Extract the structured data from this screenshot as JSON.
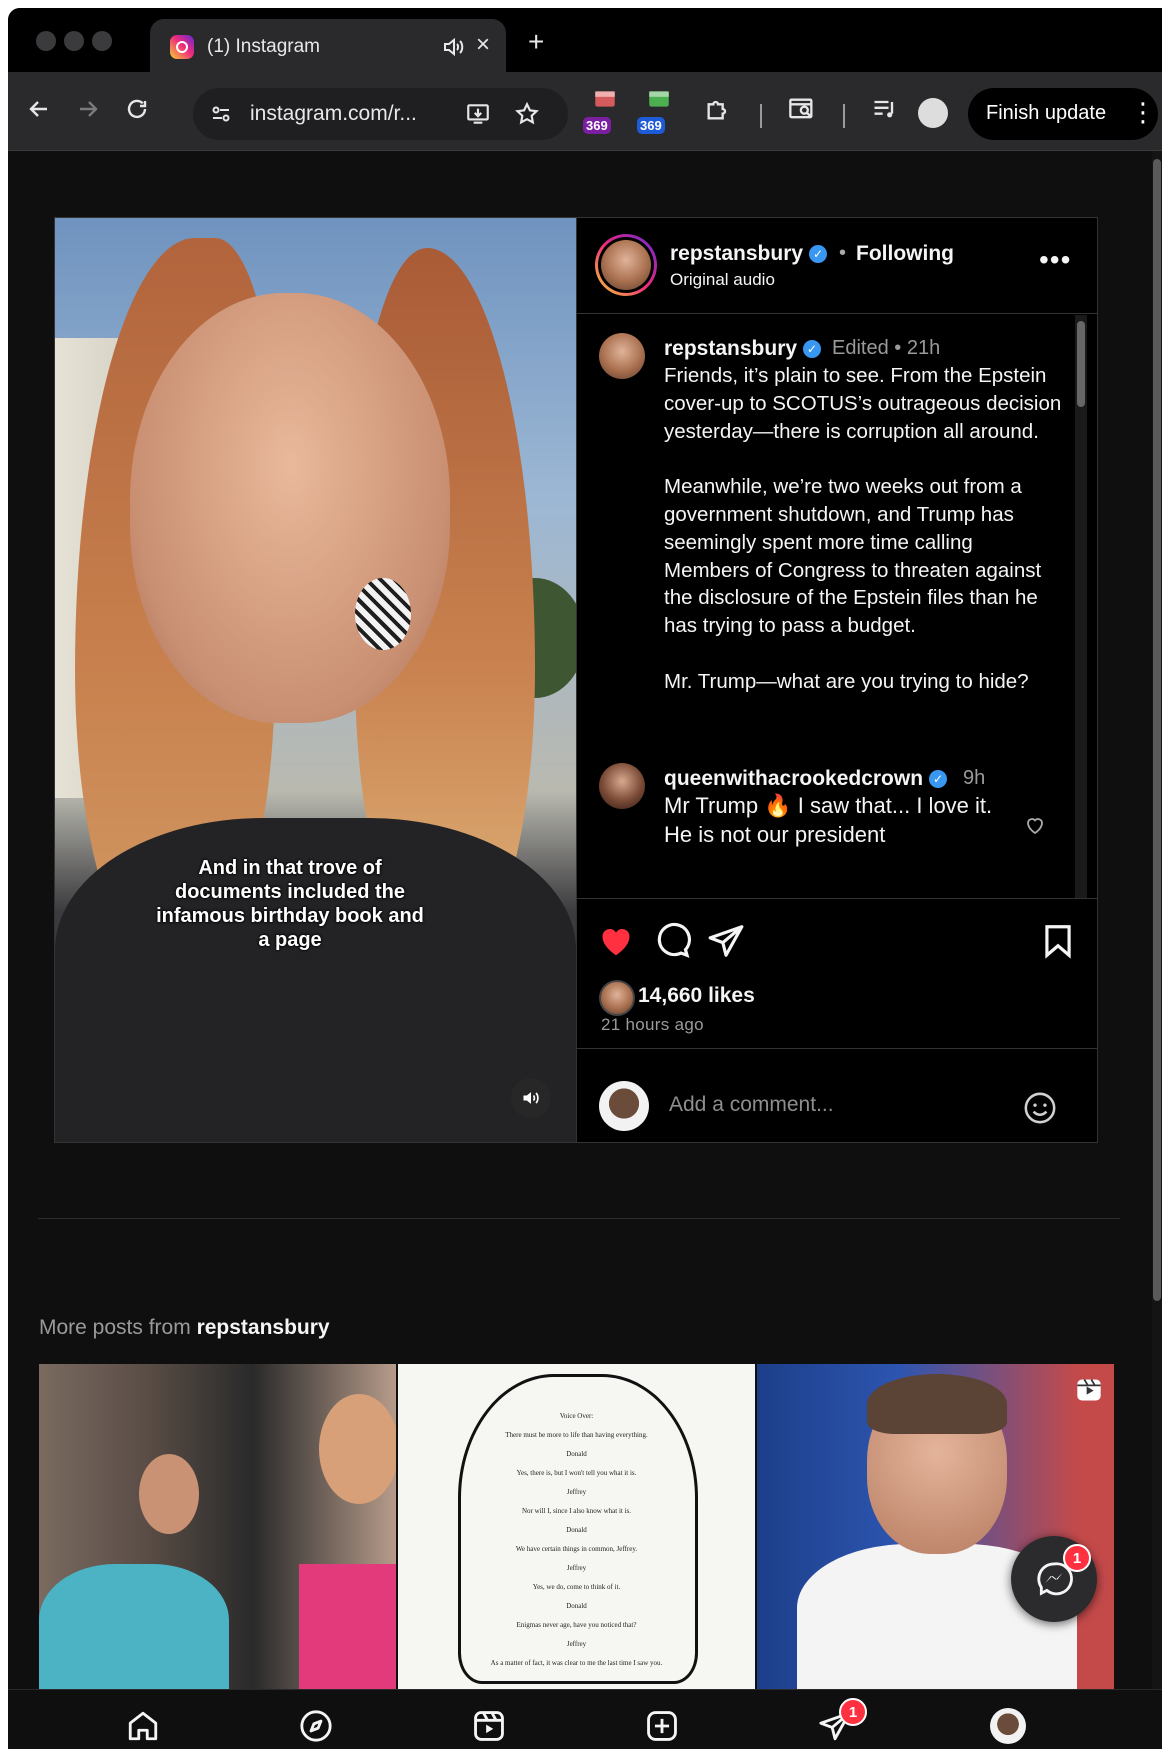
{
  "browser": {
    "tab_title": "(1) Instagram",
    "url": "instagram.com/r...",
    "extension_badges": [
      "369",
      "369"
    ],
    "finish_update_label": "Finish update"
  },
  "post": {
    "header": {
      "username": "repstansbury",
      "separator": "•",
      "follow_status": "Following",
      "audio": "Original audio"
    },
    "video_caption": "And in that trove of documents included the infamous birthday book and a page",
    "caption": {
      "username": "repstansbury",
      "meta": "Edited • 21h",
      "text": "Friends, it’s plain to see. From the Epstein cover-up to SCOTUS’s outrageous decision yesterday—there is corruption all around.\n\nMeanwhile, we’re two weeks out from a government shutdown, and Trump has seemingly spent more time calling Members of Congress to threaten against the disclosure of the Epstein files than he has trying to pass a budget.\n\nMr. Trump—what are you trying to hide?"
    },
    "comment": {
      "username": "queenwithacrookedcrown",
      "time": "9h",
      "text": "Mr Trump 🔥 I saw that... I love it. He is not our president"
    },
    "likes": "14,660 likes",
    "time_ago": "21 hours ago",
    "comment_placeholder": "Add a comment..."
  },
  "more_posts": {
    "prefix": "More posts from",
    "username": "repstansbury"
  },
  "grid_doc_lines": [
    "Voice Over:",
    "There must be more to life than having everything.",
    "Donald",
    "Yes, there is, but I won't tell you what it is.",
    "Jeffrey",
    "Nor will I, since I also know what it is.",
    "Donald",
    "We have certain things in common, Jeffrey.",
    "Jeffrey",
    "Yes, we do, come to think of it.",
    "Donald",
    "Enigmas never age, have you noticed that?",
    "Jeffrey",
    "As a matter of fact, it was clear to me the last time I saw you."
  ],
  "notifications": {
    "messenger_count": "1",
    "nav_messages_count": "1"
  },
  "colors": {
    "like_red": "#ff3040",
    "verified_blue": "#3897f0",
    "background": "#0f0f10"
  }
}
